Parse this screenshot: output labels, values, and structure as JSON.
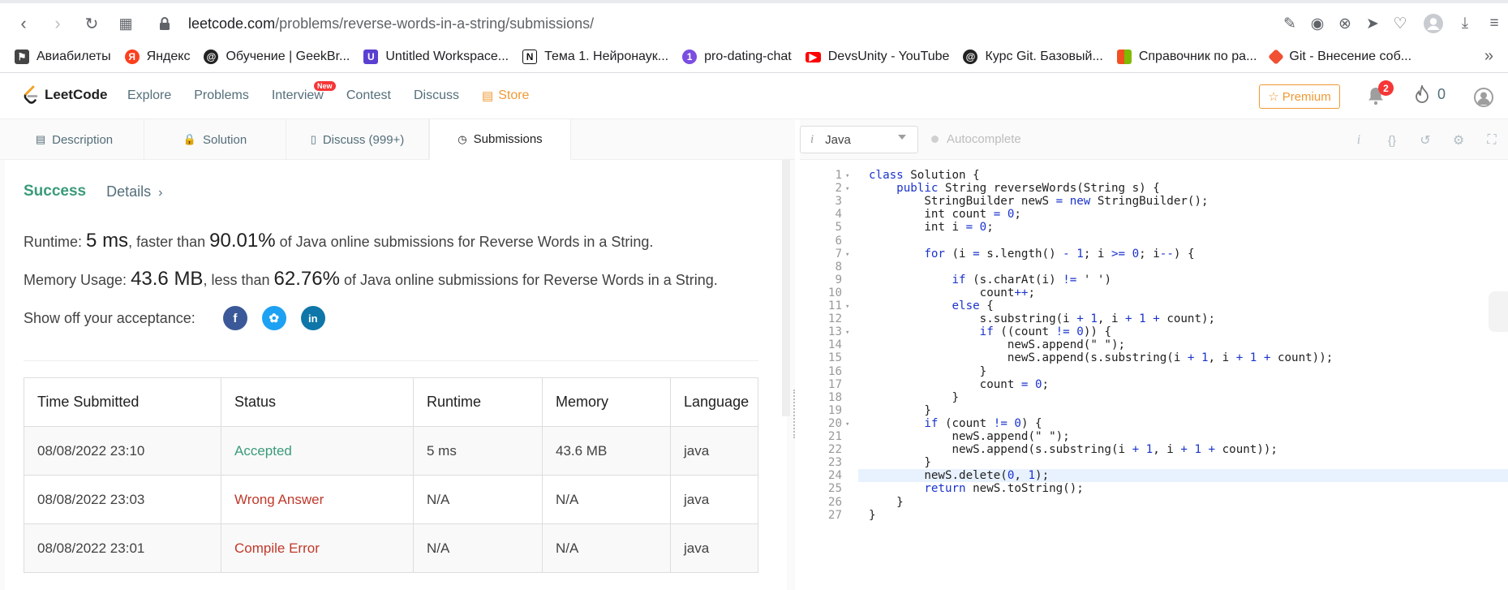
{
  "browser": {
    "url_host": "leetcode.com",
    "url_path": "/problems/reverse-words-in-a-string/submissions/",
    "bookmarks": [
      {
        "label": "Авиабилеты",
        "icon": "flag-icon",
        "color": "#444444"
      },
      {
        "label": "Яндекс",
        "icon": "yandex-icon",
        "color": "#fc3f1d"
      },
      {
        "label": "Обучение | GeekBr...",
        "icon": "geekbrains-icon",
        "color": "#222222"
      },
      {
        "label": "Untitled Workspace...",
        "icon": "workspace-icon",
        "color": "#5b3fd1"
      },
      {
        "label": "Тема 1. Нейронаук...",
        "icon": "notion-icon",
        "color": "#111111"
      },
      {
        "label": "pro-dating-chat",
        "icon": "github-desktop-icon",
        "color": "#7b4de0"
      },
      {
        "label": "DevsUnity - YouTube",
        "icon": "youtube-icon",
        "color": "#ff0000"
      },
      {
        "label": "Курс Git. Базовый...",
        "icon": "geekbrains-icon",
        "color": "#222222"
      },
      {
        "label": "Справочник по ра...",
        "icon": "microsoft-icon",
        "color": "#00a4ef"
      },
      {
        "label": "Git - Внесение соб...",
        "icon": "git-icon",
        "color": "#f05033"
      }
    ]
  },
  "nav": {
    "logo": "LeetCode",
    "links": [
      "Explore",
      "Problems",
      "Interview",
      "Contest",
      "Discuss"
    ],
    "new_badge": "New",
    "store": "Store",
    "premium": "Premium",
    "notifications": "2",
    "streak": "0"
  },
  "tabs": [
    "Description",
    "Solution",
    "Discuss (999+)",
    "Submissions"
  ],
  "result": {
    "status": "Success",
    "details": "Details",
    "runtime_label": "Runtime:",
    "runtime_value": "5 ms",
    "runtime_faster": ", faster than",
    "runtime_pct": "90.01%",
    "runtime_suffix": "of Java online submissions for Reverse Words in a String.",
    "memory_label": "Memory Usage:",
    "memory_value": "43.6 MB",
    "memory_less": ", less than",
    "memory_pct": "62.76%",
    "memory_suffix": "of Java online submissions for Reverse Words in a String.",
    "share_label": "Show off your acceptance:"
  },
  "submissions": {
    "headers": [
      "Time Submitted",
      "Status",
      "Runtime",
      "Memory",
      "Language"
    ],
    "rows": [
      {
        "time": "08/08/2022 23:10",
        "status": "Accepted",
        "status_color": "#3a9b7a",
        "runtime": "5 ms",
        "memory": "43.6 MB",
        "language": "java"
      },
      {
        "time": "08/08/2022 23:03",
        "status": "Wrong Answer",
        "status_color": "#c0392b",
        "runtime": "N/A",
        "memory": "N/A",
        "language": "java"
      },
      {
        "time": "08/08/2022 23:01",
        "status": "Compile Error",
        "status_color": "#c0392b",
        "runtime": "N/A",
        "memory": "N/A",
        "language": "java"
      }
    ]
  },
  "editor": {
    "language": "Java",
    "autocomplete": "Autocomplete",
    "lines": [
      {
        "n": "1",
        "fold": true,
        "code": "class Solution {"
      },
      {
        "n": "2",
        "fold": true,
        "code": "    public String reverseWords(String s) {"
      },
      {
        "n": "3",
        "fold": false,
        "code": "        StringBuilder newS = new StringBuilder();"
      },
      {
        "n": "4",
        "fold": false,
        "code": "        int count = 0;"
      },
      {
        "n": "5",
        "fold": false,
        "code": "        int i = 0;"
      },
      {
        "n": "6",
        "fold": false,
        "code": ""
      },
      {
        "n": "7",
        "fold": true,
        "code": "        for (i = s.length() - 1; i >= 0; i--) {"
      },
      {
        "n": "8",
        "fold": false,
        "code": ""
      },
      {
        "n": "9",
        "fold": false,
        "code": "            if (s.charAt(i) != ' ')"
      },
      {
        "n": "10",
        "fold": false,
        "code": "                count++;"
      },
      {
        "n": "11",
        "fold": true,
        "code": "            else {"
      },
      {
        "n": "12",
        "fold": false,
        "code": "                s.substring(i + 1, i + 1 + count);"
      },
      {
        "n": "13",
        "fold": true,
        "code": "                if ((count != 0)) {"
      },
      {
        "n": "14",
        "fold": false,
        "code": "                    newS.append(\" \");"
      },
      {
        "n": "15",
        "fold": false,
        "code": "                    newS.append(s.substring(i + 1, i + 1 + count));"
      },
      {
        "n": "16",
        "fold": false,
        "code": "                }"
      },
      {
        "n": "17",
        "fold": false,
        "code": "                count = 0;"
      },
      {
        "n": "18",
        "fold": false,
        "code": "            }"
      },
      {
        "n": "19",
        "fold": false,
        "code": "        }"
      },
      {
        "n": "20",
        "fold": true,
        "code": "        if (count != 0) {"
      },
      {
        "n": "21",
        "fold": false,
        "code": "            newS.append(\" \");"
      },
      {
        "n": "22",
        "fold": false,
        "code": "            newS.append(s.substring(i + 1, i + 1 + count));"
      },
      {
        "n": "23",
        "fold": false,
        "code": "        }"
      },
      {
        "n": "24",
        "fold": false,
        "code": "        newS.delete(0, 1);"
      },
      {
        "n": "25",
        "fold": false,
        "code": "        return newS.toString();"
      },
      {
        "n": "26",
        "fold": false,
        "code": "    }"
      },
      {
        "n": "27",
        "fold": false,
        "code": "}"
      }
    ],
    "current_line": "24"
  },
  "colors": {
    "accent_green": "#3a9b7a",
    "error_red": "#c0392b",
    "store_orange": "#ef9a34",
    "facebook": "#3b5998",
    "twitter": "#1da1f2",
    "linkedin": "#0e76a8"
  }
}
